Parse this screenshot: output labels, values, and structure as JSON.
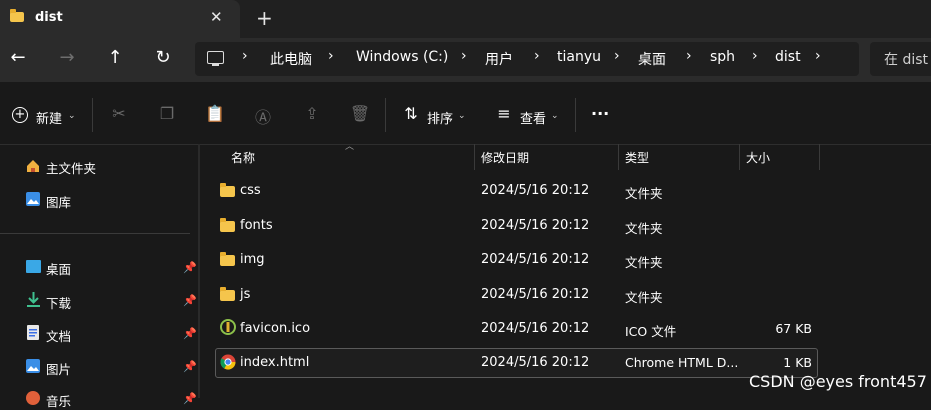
{
  "tab": {
    "title": "dist",
    "close": "✕",
    "new_tab": "+"
  },
  "nav": {
    "back": "←",
    "forward": "→",
    "up": "↑",
    "refresh": "↻"
  },
  "breadcrumb": {
    "items": [
      "此电脑",
      "Windows (C:)",
      "用户",
      "tianyu",
      "桌面",
      "sph",
      "dist"
    ],
    "separator": "›"
  },
  "search": {
    "placeholder": "在 dist"
  },
  "command_bar": {
    "new_label": "新建",
    "sort_label": "排序",
    "view_label": "查看",
    "more_label": "···",
    "icons": [
      "cut-icon",
      "copy-icon",
      "paste-icon",
      "rename-icon",
      "share-icon",
      "delete-icon"
    ]
  },
  "sidebar": {
    "items": [
      {
        "label": "主文件夹",
        "icon": "home-icon",
        "pinned": false
      },
      {
        "label": "图库",
        "icon": "gallery-icon",
        "pinned": false
      },
      {
        "label": "桌面",
        "icon": "desktop-icon",
        "pinned": true
      },
      {
        "label": "下载",
        "icon": "download-icon",
        "pinned": true
      },
      {
        "label": "文档",
        "icon": "documents-icon",
        "pinned": true
      },
      {
        "label": "图片",
        "icon": "pictures-icon",
        "pinned": true
      },
      {
        "label": "音乐",
        "icon": "music-icon",
        "pinned": true
      }
    ]
  },
  "columns": {
    "name": "名称",
    "modified": "修改日期",
    "type": "类型",
    "size": "大小"
  },
  "files": [
    {
      "name": "css",
      "modified": "2024/5/16 20:12",
      "type": "文件夹",
      "size": "",
      "icon": "folder-icon"
    },
    {
      "name": "fonts",
      "modified": "2024/5/16 20:12",
      "type": "文件夹",
      "size": "",
      "icon": "folder-icon"
    },
    {
      "name": "img",
      "modified": "2024/5/16 20:12",
      "type": "文件夹",
      "size": "",
      "icon": "folder-icon"
    },
    {
      "name": "js",
      "modified": "2024/5/16 20:12",
      "type": "文件夹",
      "size": "",
      "icon": "folder-icon"
    },
    {
      "name": "favicon.ico",
      "modified": "2024/5/16 20:12",
      "type": "ICO 文件",
      "size": "67 KB",
      "icon": "favicon-icon"
    },
    {
      "name": "index.html",
      "modified": "2024/5/16 20:12",
      "type": "Chrome HTML D...",
      "size": "1 KB",
      "icon": "chrome-icon"
    }
  ],
  "watermark": "CSDN @eyes front457",
  "colors": {
    "background": "#191919",
    "folder": "#f5c54c",
    "selection_border": "#5a5a5a"
  }
}
